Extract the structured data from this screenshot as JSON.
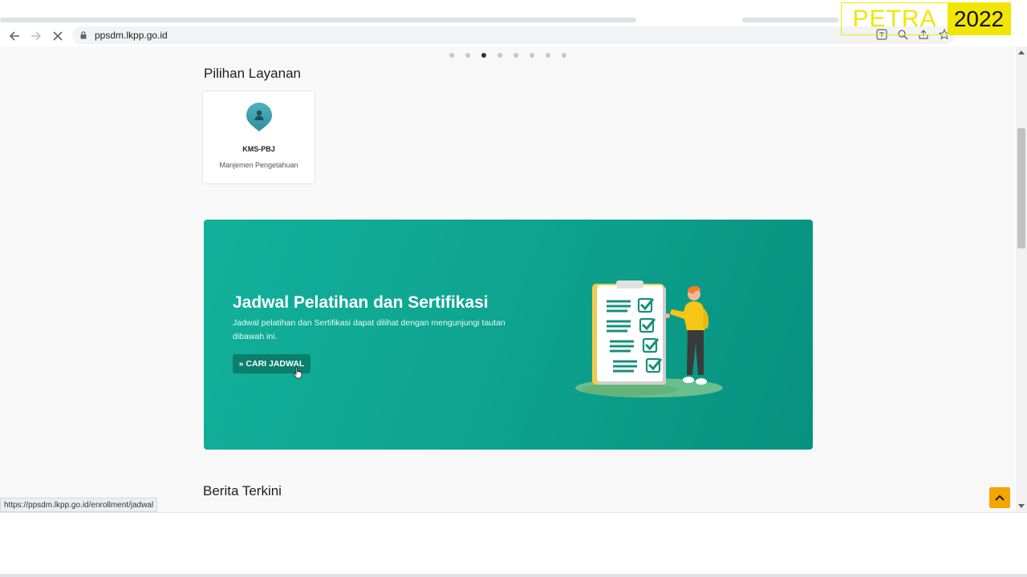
{
  "browser": {
    "url": "ppsdm.lkpp.go.id",
    "status_url": "https://ppsdm.lkpp.go.id/enrollment/jadwal"
  },
  "watermark": {
    "word": "PETRA",
    "year": "2022"
  },
  "carousel": {
    "dot_count": 8,
    "active_index": 2
  },
  "services": {
    "title": "Pilihan Layanan",
    "cards": [
      {
        "name": "KMS-PBJ",
        "description": "Manjemen Pengetahuan",
        "icon": "person-pin-icon"
      }
    ]
  },
  "banner": {
    "title": "Jadwal Pelatihan dan Sertifikasi",
    "text": "Jadwal pelatihan dan Sertifikasi dapat dilihat dengan mengunjungi tautan dibawah ini.",
    "button_label": "» CARI JADWAL"
  },
  "news": {
    "title": "Berita Terkini"
  },
  "colors": {
    "banner": "#0ea590",
    "button": "#0a7f6d",
    "to_top": "#f5a500",
    "watermark": "#f2e600"
  }
}
